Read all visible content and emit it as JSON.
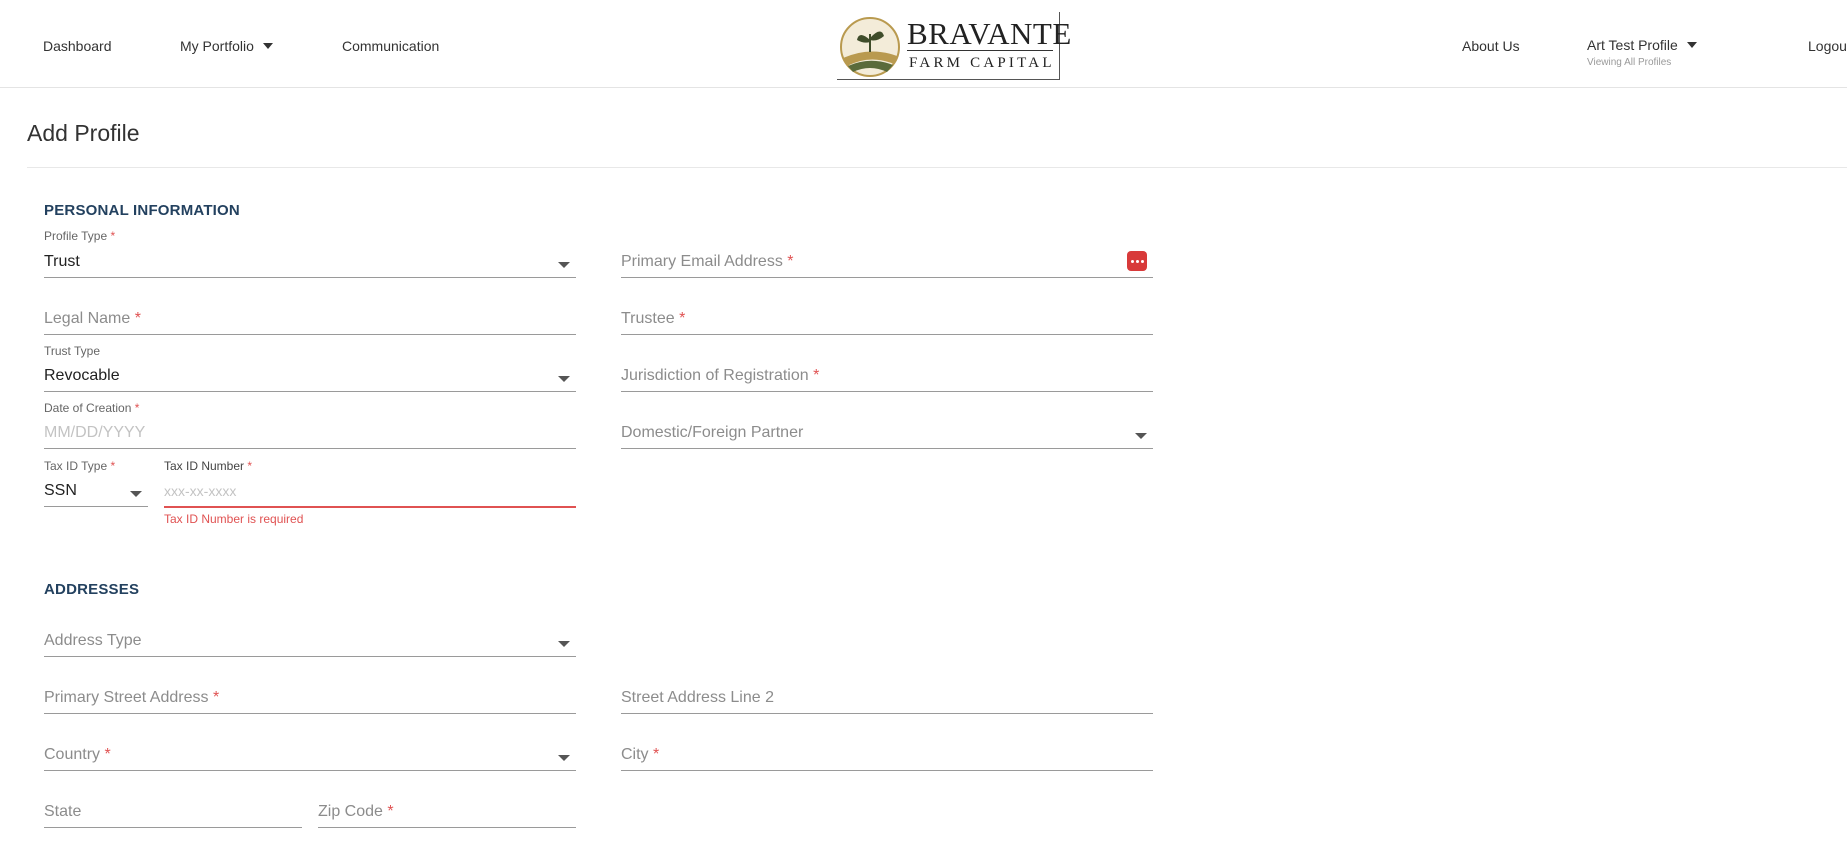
{
  "nav": {
    "dashboard": "Dashboard",
    "my_portfolio": "My Portfolio",
    "communication": "Communication",
    "about_us": "About Us",
    "profile_name": "Art Test Profile",
    "profile_sub": "Viewing All Profiles",
    "logout": "Logou"
  },
  "logo": {
    "title": "BRAVANTE",
    "subtitle": "FARM CAPITAL"
  },
  "page": {
    "title": "Add Profile"
  },
  "personal": {
    "section_title": "PERSONAL INFORMATION",
    "profile_type": {
      "label": "Profile Type",
      "value": "Trust"
    },
    "primary_email": {
      "label": "Primary Email Address"
    },
    "legal_name": {
      "label": "Legal Name"
    },
    "trustee": {
      "label": "Trustee"
    },
    "trust_type": {
      "label": "Trust Type",
      "value": "Revocable"
    },
    "jurisdiction": {
      "label": "Jurisdiction of Registration"
    },
    "date_of_creation": {
      "label": "Date of Creation",
      "placeholder": "MM/DD/YYYY"
    },
    "domestic_foreign": {
      "label": "Domestic/Foreign Partner"
    },
    "tax_id_type": {
      "label": "Tax ID Type",
      "value": "SSN"
    },
    "tax_id_number": {
      "label": "Tax ID Number",
      "placeholder": "xxx-xx-xxxx",
      "error": "Tax ID Number is required"
    }
  },
  "addresses": {
    "section_title": "ADDRESSES",
    "address_type": {
      "label": "Address Type"
    },
    "primary_street": {
      "label": "Primary Street Address"
    },
    "street_line2": {
      "label": "Street Address Line 2"
    },
    "country": {
      "label": "Country"
    },
    "city": {
      "label": "City"
    },
    "state": {
      "label": "State"
    },
    "zip": {
      "label": "Zip Code"
    }
  },
  "required_mark": "*",
  "colors": {
    "accent": "#23415f",
    "error": "#e05252",
    "icon_red": "#d83a3a"
  },
  "icons": [
    "caret-down-icon",
    "password-manager-icon",
    "logo-emblem-icon"
  ]
}
